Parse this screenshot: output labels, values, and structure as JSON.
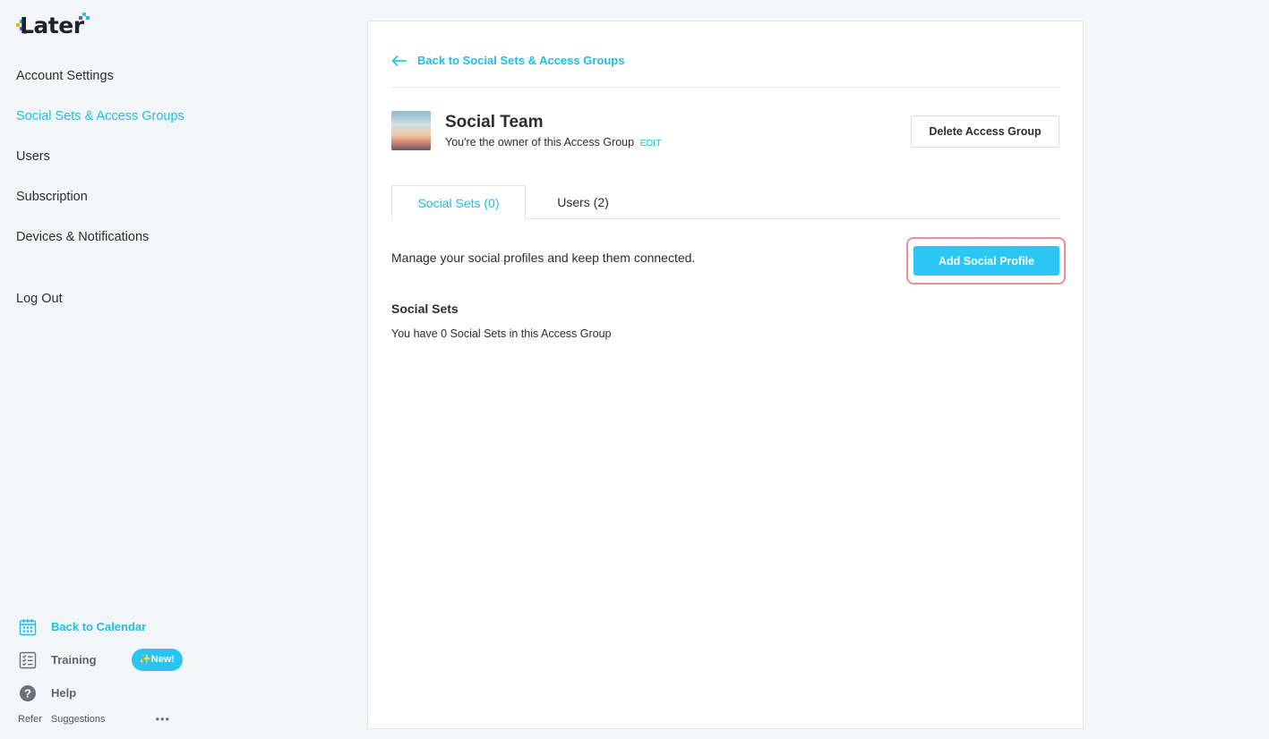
{
  "brand": {
    "logo_text": "Later",
    "accent_color": "#1dbde8",
    "button_color": "#2bc6f3",
    "highlight_color": "#f09090"
  },
  "sidebar": {
    "items": [
      {
        "label": "Account Settings",
        "active": false
      },
      {
        "label": "Social Sets & Access Groups",
        "active": true
      },
      {
        "label": "Users",
        "active": false
      },
      {
        "label": "Subscription",
        "active": false
      },
      {
        "label": "Devices & Notifications",
        "active": false
      }
    ],
    "logout_label": "Log Out",
    "bottom": {
      "calendar_label": "Back to Calendar",
      "calendar_icon": "calendar-icon",
      "training_label": "Training",
      "training_icon": "checklist-icon",
      "training_badge": "✨New!",
      "help_label": "Help",
      "help_icon": "question-circle-icon"
    },
    "footer": {
      "refer_label": "Refer",
      "suggestions_label": "Suggestions",
      "more_label": "•••"
    }
  },
  "main": {
    "back_label": "Back to Social Sets & Access Groups",
    "group": {
      "title": "Social Team",
      "subtitle": "You're the owner of this Access Group",
      "edit_label": "EDIT"
    },
    "delete_label": "Delete Access Group",
    "tabs": [
      {
        "label": "Social Sets (0)",
        "active": true
      },
      {
        "label": "Users (2)",
        "active": false
      }
    ],
    "manage_text": "Manage your social profiles and keep them connected.",
    "add_label": "Add Social Profile",
    "sets_heading": "Social Sets",
    "sets_count_text": "You have 0 Social Sets in this Access Group"
  }
}
